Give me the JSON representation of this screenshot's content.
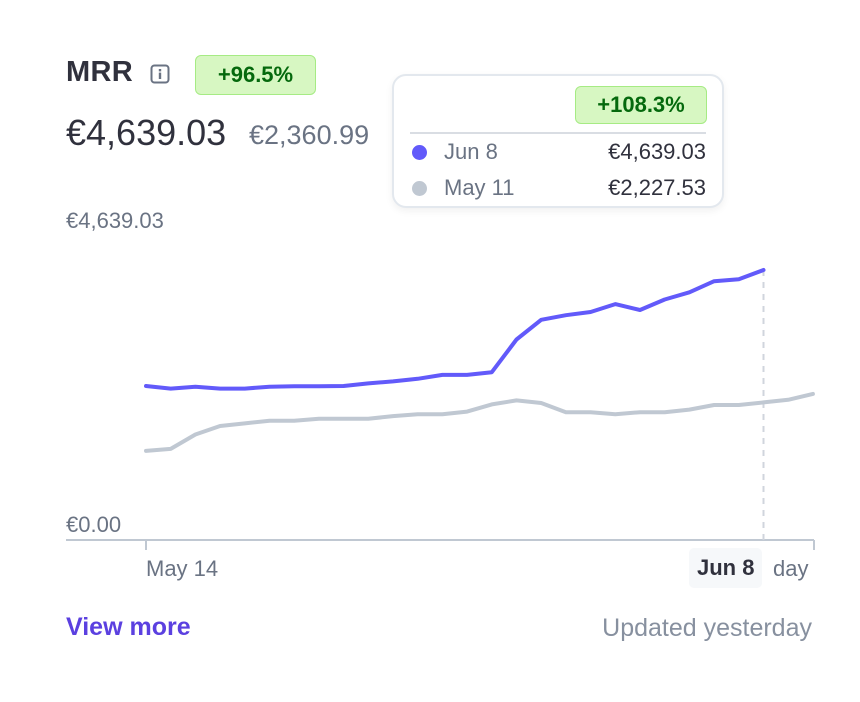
{
  "metric": {
    "title": "MRR",
    "change_badge": "+96.5%",
    "current_value": "€4,639.03",
    "compare_value": "€2,360.99"
  },
  "tooltip": {
    "change_badge": "+108.3%",
    "rows": [
      {
        "date": "Jun 8",
        "amount": "€4,639.03",
        "color": "#625afa"
      },
      {
        "date": "May 11",
        "amount": "€2,227.53",
        "color": "#c0c8d2"
      }
    ]
  },
  "footer": {
    "view_more": "View more",
    "updated": "Updated yesterday"
  },
  "colors": {
    "primary_series": "#625afa",
    "comparison_series": "#c0c8d2",
    "badge_bg": "#d7f7c2",
    "badge_text": "#05690d",
    "link": "#5b40e0"
  },
  "icons": {
    "info": "info-icon"
  },
  "chart_data": {
    "type": "line",
    "ylim": [
      0,
      4639.03
    ],
    "y_tick_labels": [
      "€4,639.03",
      "€0.00"
    ],
    "x_tick_labels": [
      "May 14",
      "Jun 8"
    ],
    "x_unit": "day",
    "highlight_index": 25,
    "series": [
      {
        "values": [
          2350,
          2310,
          2340,
          2310,
          2310,
          2340,
          2345,
          2345,
          2350,
          2390,
          2420,
          2460,
          2520,
          2520,
          2560,
          3060,
          3360,
          3430,
          3480,
          3600,
          3510,
          3670,
          3780,
          3950,
          3980,
          4120
        ]
      },
      {
        "values": [
          1360,
          1390,
          1610,
          1740,
          1780,
          1820,
          1820,
          1850,
          1850,
          1850,
          1890,
          1920,
          1920,
          1960,
          2070,
          2130,
          2090,
          1950,
          1950,
          1920,
          1950,
          1950,
          1990,
          2060,
          2060,
          2100,
          2140,
          2230
        ]
      }
    ]
  }
}
